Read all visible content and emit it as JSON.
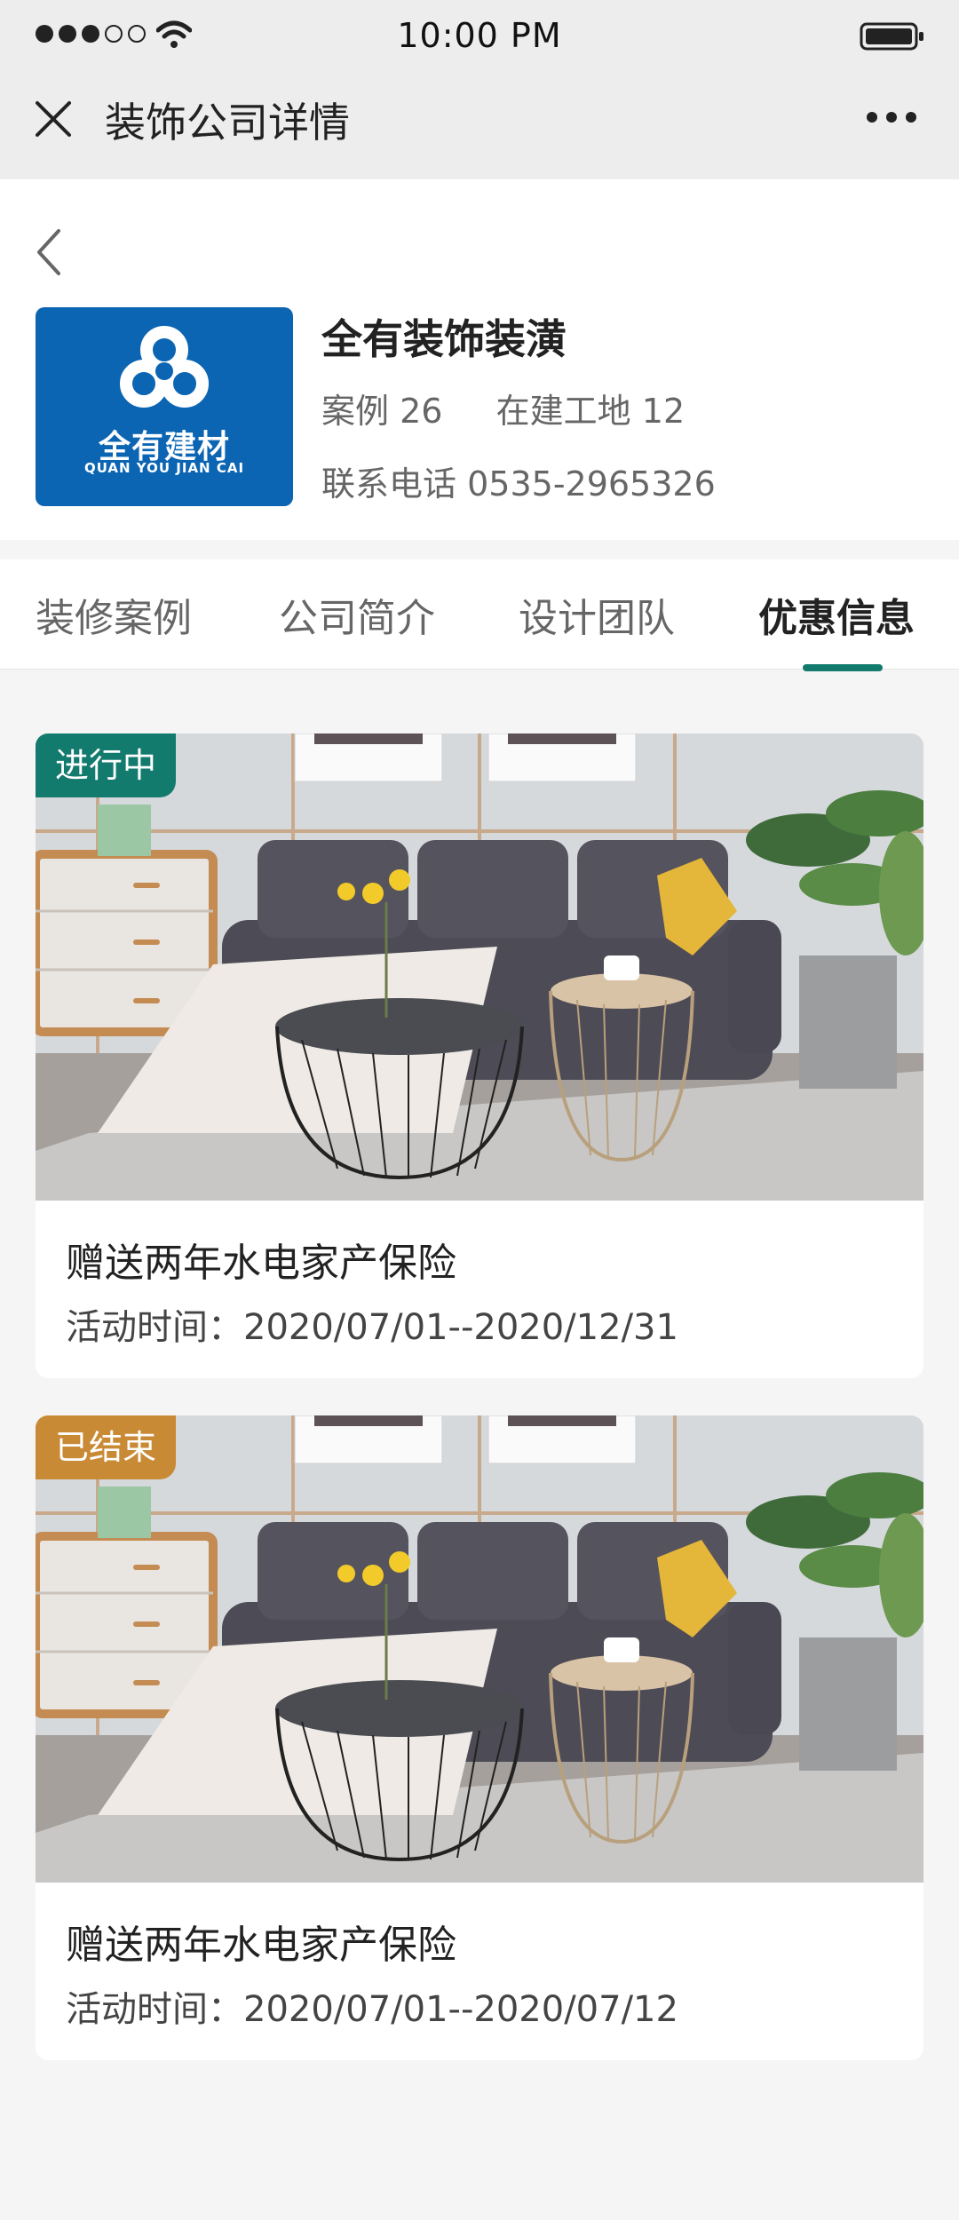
{
  "status_bar": {
    "time": "10:00 PM"
  },
  "nav": {
    "title": "装饰公司详情"
  },
  "company": {
    "name": "全有装饰装潢",
    "logo_text": "全有建材",
    "logo_subtext": "QUAN YOU JIAN CAI",
    "cases_label": "案例",
    "cases_count": "26",
    "sites_label": "在建工地",
    "sites_count": "12",
    "phone_label": "联系电话",
    "phone": "0535-2965326"
  },
  "tabs": [
    {
      "label": "装修案例"
    },
    {
      "label": "公司简介"
    },
    {
      "label": "设计团队"
    },
    {
      "label": "优惠信息",
      "active": true
    }
  ],
  "promotions": [
    {
      "status": "进行中",
      "status_color": "#137a6e",
      "title": "赠送两年水电家产保险",
      "time": "活动时间：2020/07/01--2020/12/31"
    },
    {
      "status": "已结束",
      "status_color": "#c98a36",
      "title": "赠送两年水电家产保险",
      "time": "活动时间：2020/07/01--2020/07/12"
    }
  ],
  "colors": {
    "accent": "#137a6e",
    "ended": "#c98a36",
    "logo_bg": "#0b65b3"
  }
}
